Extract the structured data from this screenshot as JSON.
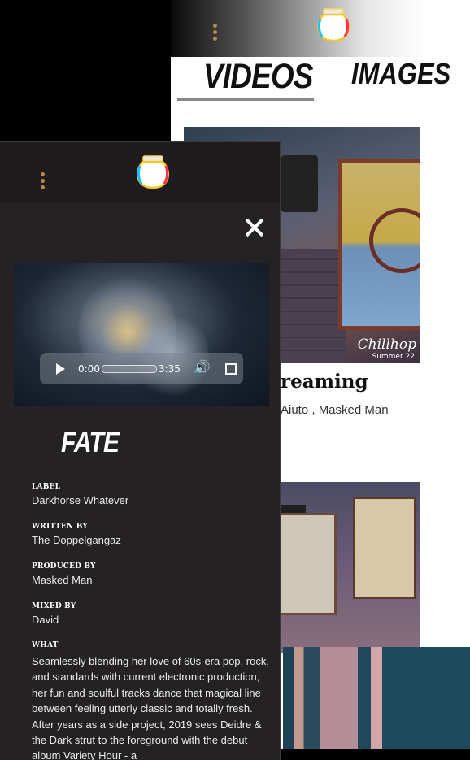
{
  "background_page": {
    "tabs": [
      {
        "label": "VIDEOS",
        "active": true
      },
      {
        "label": "IMAGES",
        "active": false
      }
    ],
    "card1": {
      "title_visible": "reaming",
      "artists_visible": "Aiuto , Masked Man",
      "art_brand": "Chillhop",
      "art_sub": "Summer 22"
    }
  },
  "player": {
    "current_time": "0:00",
    "duration": "3:35",
    "song_title": "FATE",
    "fields": [
      {
        "label": "LABEL",
        "value": "Darkhorse Whatever"
      },
      {
        "label": "WRITTEN BY",
        "value": "The Doppelgangaz"
      },
      {
        "label": "PRODUCED BY",
        "value": "Masked Man"
      },
      {
        "label": "MIXED BY",
        "value": "David"
      }
    ],
    "what_label": "WHAT",
    "what_text": "Seamlessly blending her love of 60s-era pop, rock, and standards with current electronic production, her fun and soulful tracks dance that magical line between feeling utterly classic and totally fresh. After years as a side project, 2019 sees Deidre & the Dark strut to the foreground with the debut album Variety Hour - a"
  },
  "icons": {
    "menu": "kebab-menu-icon",
    "logo": "fishbowl-logo",
    "close": "close-icon",
    "play": "play-icon",
    "volume": "volume-icon",
    "fullscreen": "fullscreen-icon"
  },
  "colors": {
    "panel_bg": "#252223",
    "menu_dots": "#b8894b",
    "accent_text": "#ffffff"
  }
}
